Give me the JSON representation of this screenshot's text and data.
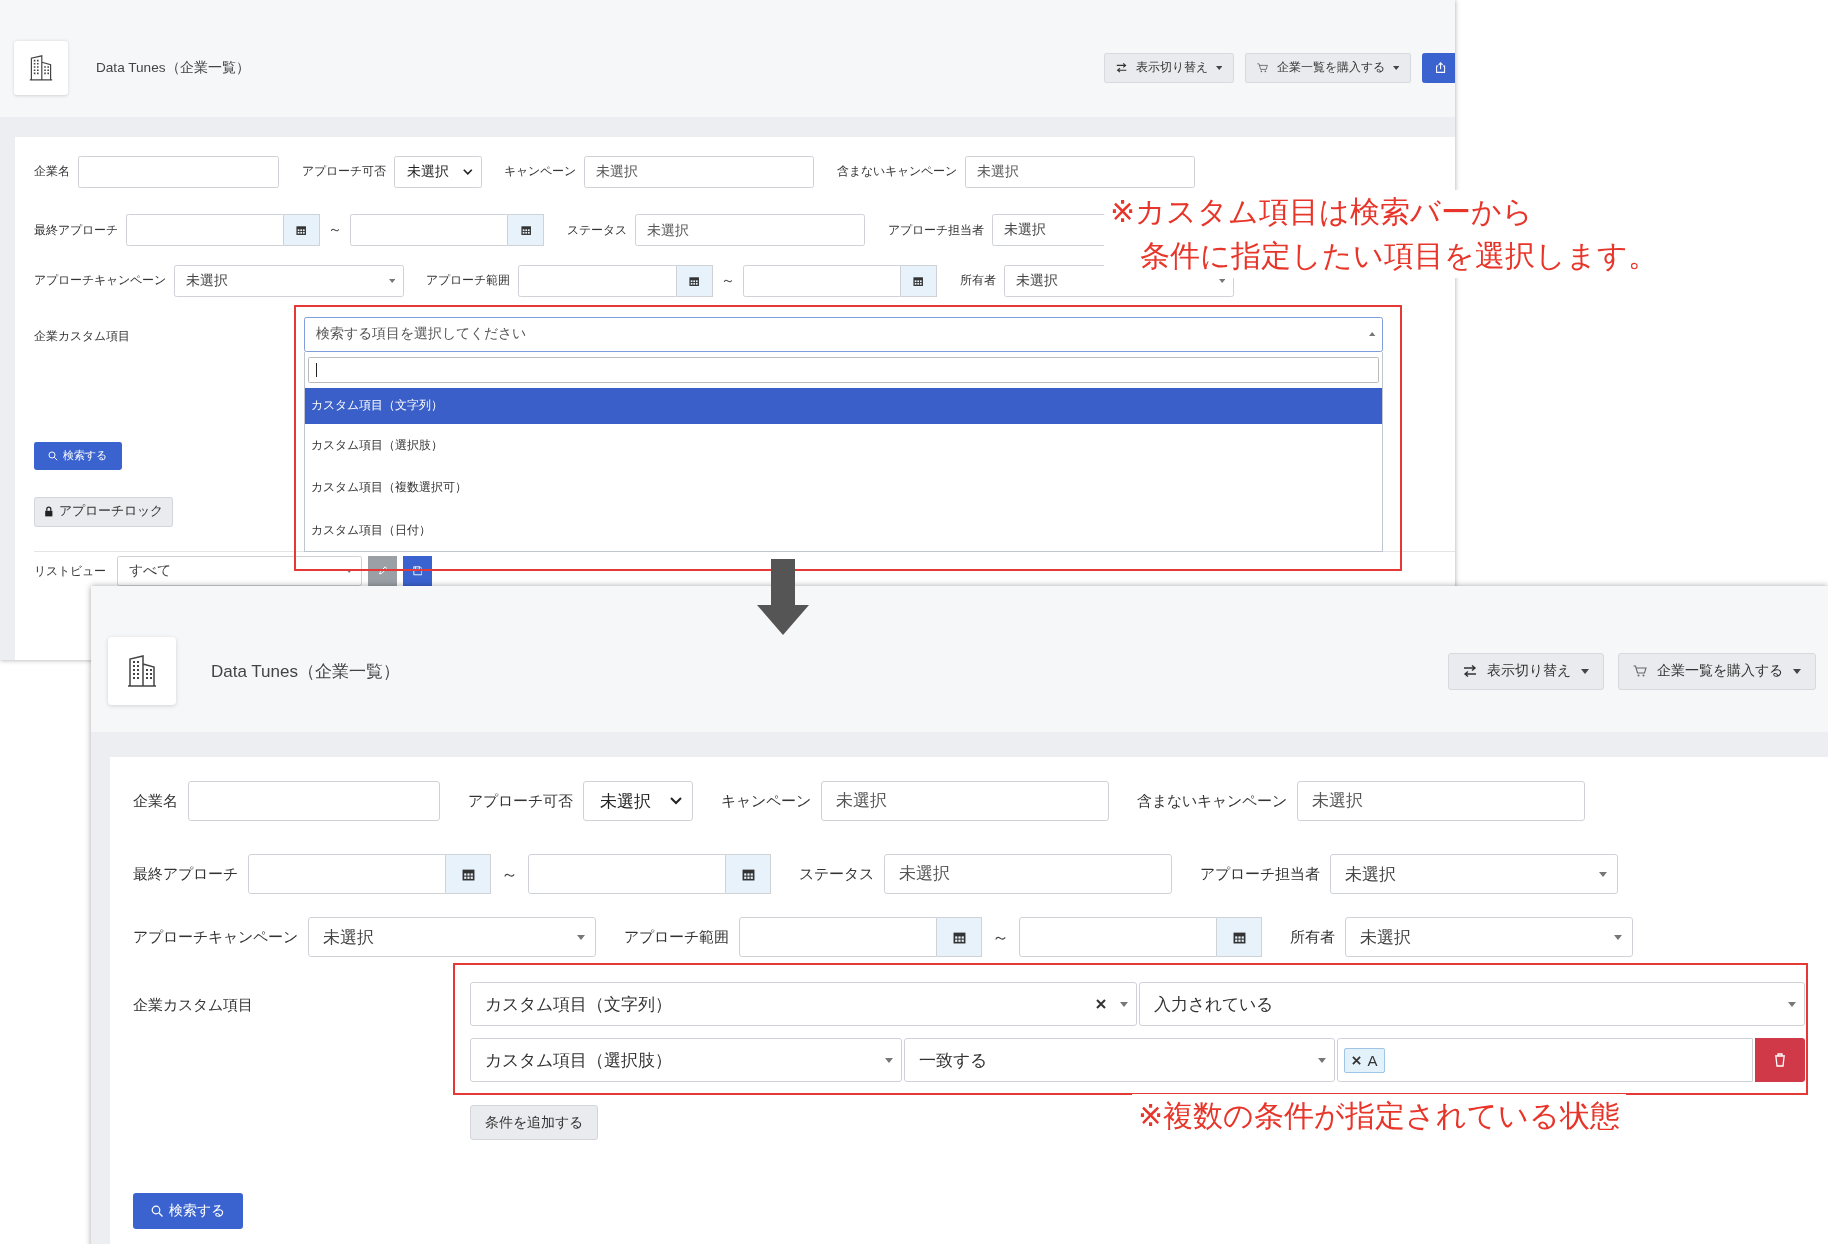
{
  "before": {
    "header": {
      "title": "Data Tunes（企業一覧）",
      "buttons": [
        {
          "kind": "toggle",
          "label": "表示切り替え"
        },
        {
          "kind": "purchase",
          "label": "企業一覧を購入する"
        },
        {
          "kind": "action"
        }
      ]
    },
    "filters": [
      [
        {
          "kind": "text",
          "label": "企業名"
        },
        {
          "kind": "native_select",
          "label": "アプローチ可否",
          "value": "未選択"
        },
        {
          "kind": "text",
          "label": "キャンペーン",
          "placeholder": "未選択"
        },
        {
          "kind": "text",
          "label": "含まないキャンペーン",
          "placeholder": "未選択"
        }
      ],
      [
        {
          "kind": "date_range",
          "label": "最終アプローチ",
          "separator": "～"
        },
        {
          "kind": "text",
          "label": "ステータス",
          "placeholder": "未選択"
        },
        {
          "kind": "select",
          "label": "アプローチ担当者",
          "value": "未選択"
        }
      ],
      [
        {
          "kind": "select",
          "label": "アプローチキャンペーン",
          "value": "未選択"
        },
        {
          "kind": "date_range",
          "label": "アプローチ範囲",
          "separator": "～"
        },
        {
          "kind": "select",
          "label": "所有者",
          "value": "未選択"
        }
      ]
    ],
    "custom": {
      "label": "企業カスタム項目",
      "dropdown": {
        "placeholder": "検索する項目を選択してください",
        "options": [
          {
            "label": "カスタム項目（文字列）",
            "selected": true
          },
          {
            "label": "カスタム項目（選択肢）",
            "selected": false
          },
          {
            "label": "カスタム項目（複数選択可）",
            "selected": false
          },
          {
            "label": "カスタム項目（日付）",
            "selected": false
          }
        ]
      }
    },
    "search_button": "検索する",
    "lock_button": "アプローチロック",
    "list_view": {
      "label": "リストビュー",
      "value": "すべて"
    }
  },
  "after": {
    "header": {
      "title": "Data Tunes（企業一覧）",
      "buttons": [
        {
          "kind": "toggle",
          "label": "表示切り替え"
        },
        {
          "kind": "purchase",
          "label": "企業一覧を購入する"
        }
      ]
    },
    "filters": [
      [
        {
          "kind": "text",
          "label": "企業名"
        },
        {
          "kind": "native_select",
          "label": "アプローチ可否",
          "value": "未選択"
        },
        {
          "kind": "text",
          "label": "キャンペーン",
          "placeholder": "未選択"
        },
        {
          "kind": "text",
          "label": "含まないキャンペーン",
          "placeholder": "未選択"
        }
      ],
      [
        {
          "kind": "date_range",
          "label": "最終アプローチ",
          "separator": "～"
        },
        {
          "kind": "text",
          "label": "ステータス",
          "placeholder": "未選択"
        },
        {
          "kind": "select",
          "label": "アプローチ担当者",
          "value": "未選択"
        }
      ],
      [
        {
          "kind": "select",
          "label": "アプローチキャンペーン",
          "value": "未選択"
        },
        {
          "kind": "date_range",
          "label": "アプローチ範囲",
          "separator": "～"
        },
        {
          "kind": "select",
          "label": "所有者",
          "value": "未選択"
        }
      ]
    ],
    "custom": {
      "label": "企業カスタム項目",
      "conditions": [
        {
          "field": "カスタム項目（文字列）",
          "clearable": true,
          "operator": "入力されている",
          "deletable": false
        },
        {
          "field": "カスタム項目（選択肢）",
          "clearable": false,
          "operator": "一致する",
          "tags": [
            "A"
          ],
          "deletable": true
        }
      ],
      "add_button": "条件を追加する"
    },
    "search_button": "検索する"
  },
  "annotations": [
    {
      "kind": "note",
      "lines": [
        "※カスタム項目は検索バーから",
        "条件に指定したい項目を選択します。"
      ]
    },
    {
      "kind": "note",
      "lines": [
        "※複数の条件が指定されている状態"
      ]
    }
  ]
}
